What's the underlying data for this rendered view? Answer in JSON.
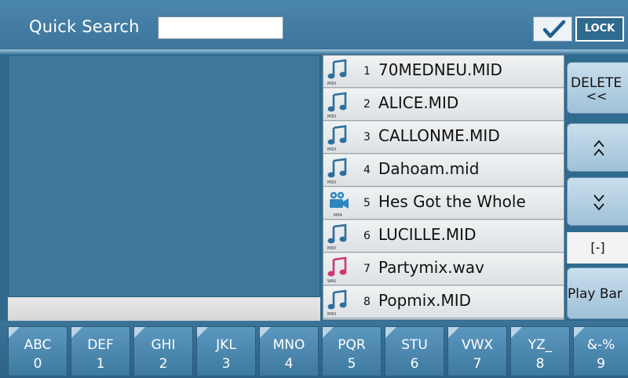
{
  "header": {
    "search_label": "Quick Search",
    "search_value": "",
    "lock_checked": true,
    "lock_label": "LOCK"
  },
  "file_list": {
    "items": [
      {
        "index": "1",
        "name": "70MEDNEU.MID",
        "type": "MIDI",
        "icon": "music-note-icon"
      },
      {
        "index": "2",
        "name": "ALICE.MID",
        "type": "MIDI",
        "icon": "music-note-icon"
      },
      {
        "index": "3",
        "name": "CALLONME.MID",
        "type": "MIDI",
        "icon": "music-note-icon"
      },
      {
        "index": "4",
        "name": "Dahoam.mid",
        "type": "MIDI",
        "icon": "music-note-icon"
      },
      {
        "index": "5",
        "name": "Hes Got the Whole",
        "type": "MP4",
        "icon": "video-camera-icon"
      },
      {
        "index": "6",
        "name": "LUCILLE.MID",
        "type": "MIDI",
        "icon": "music-note-icon"
      },
      {
        "index": "7",
        "name": "Partymix.wav",
        "type": "WAV",
        "icon": "music-note-icon"
      },
      {
        "index": "8",
        "name": "Popmix.MID",
        "type": "MIDI",
        "icon": "music-note-icon"
      }
    ]
  },
  "side_buttons": {
    "delete_line1": "DELETE",
    "delete_line2": "<<",
    "up": "^",
    "down": "v",
    "page_indicator": "[-]",
    "play_bar": "Play Bar"
  },
  "alpha_keys": [
    {
      "letters": "ABC",
      "number": "0"
    },
    {
      "letters": "DEF",
      "number": "1"
    },
    {
      "letters": "GHI",
      "number": "2"
    },
    {
      "letters": "JKL",
      "number": "3"
    },
    {
      "letters": "MNO",
      "number": "4"
    },
    {
      "letters": "PQR",
      "number": "5"
    },
    {
      "letters": "STU",
      "number": "6"
    },
    {
      "letters": "VWX",
      "number": "7"
    },
    {
      "letters": "YZ_",
      "number": "8"
    },
    {
      "letters": "&-%",
      "number": "9"
    }
  ],
  "colors": {
    "background": "#2f6a8f",
    "midi_icon": "#2e6f9e",
    "wav_icon": "#d0357a",
    "key_blue": "#4a86ad",
    "checkmark": "#1f5f8f"
  }
}
